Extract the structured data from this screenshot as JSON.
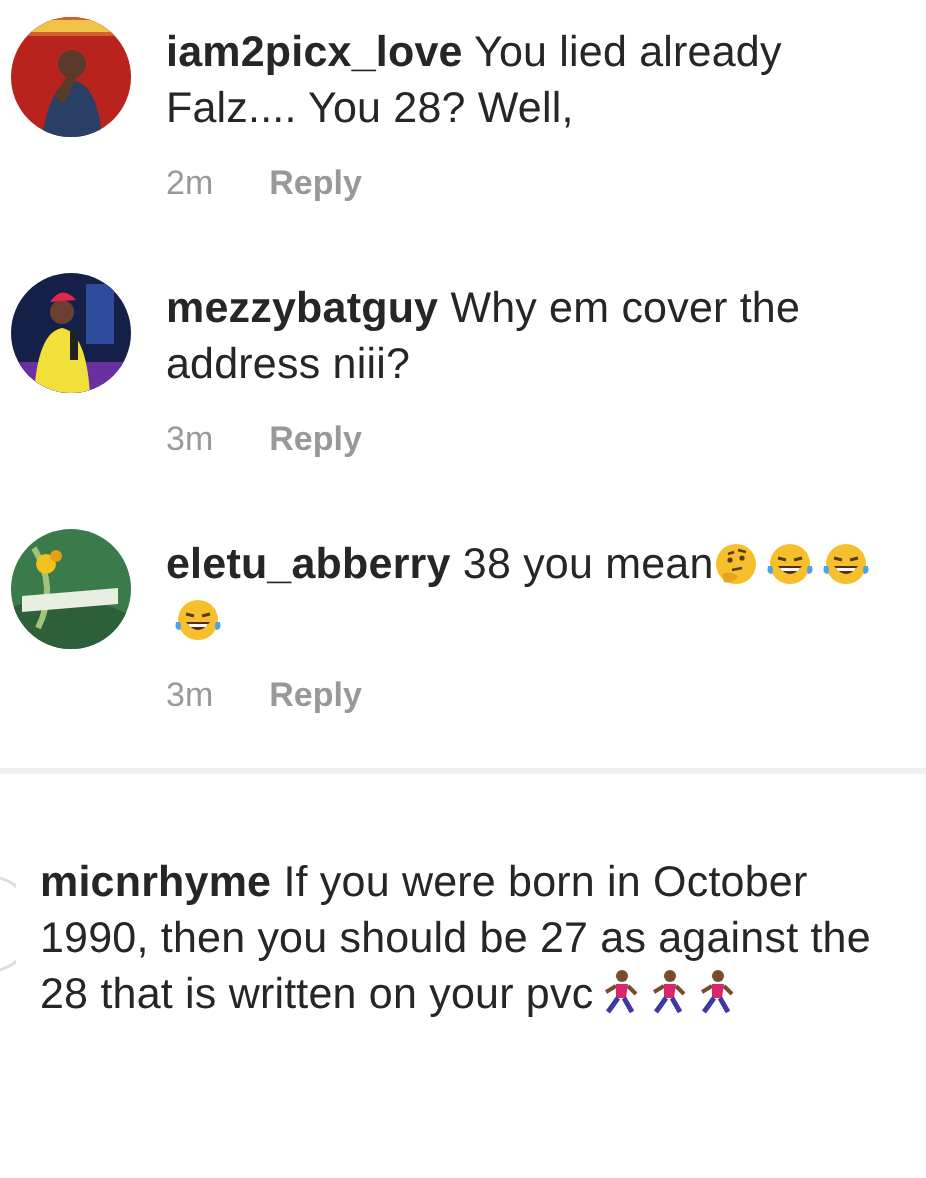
{
  "comments": [
    {
      "username": "iam2picx_love",
      "text": "You lied already Falz.... You 28? Well,",
      "time": "2m",
      "reply": "Reply"
    },
    {
      "username": "mezzybatguy",
      "text": "Why em cover the address niii?",
      "time": "3m",
      "reply": "Reply"
    },
    {
      "username": "eletu_abberry",
      "text": "38 you mean",
      "emojis": [
        {
          "kind": "thinking"
        },
        {
          "kind": "laughing"
        },
        {
          "kind": "laughing"
        },
        {
          "kind": "laughing"
        }
      ],
      "time": "3m",
      "reply": "Reply"
    },
    {
      "avatar": {
        "kind": "cut"
      },
      "username": "micnrhyme",
      "text": "If you were born in October 1990, then you should be 27 as against the 28 that is written on your pvc",
      "emojis": [
        {
          "kind": "runner"
        },
        {
          "kind": "runner"
        },
        {
          "kind": "runner"
        }
      ]
    }
  ]
}
